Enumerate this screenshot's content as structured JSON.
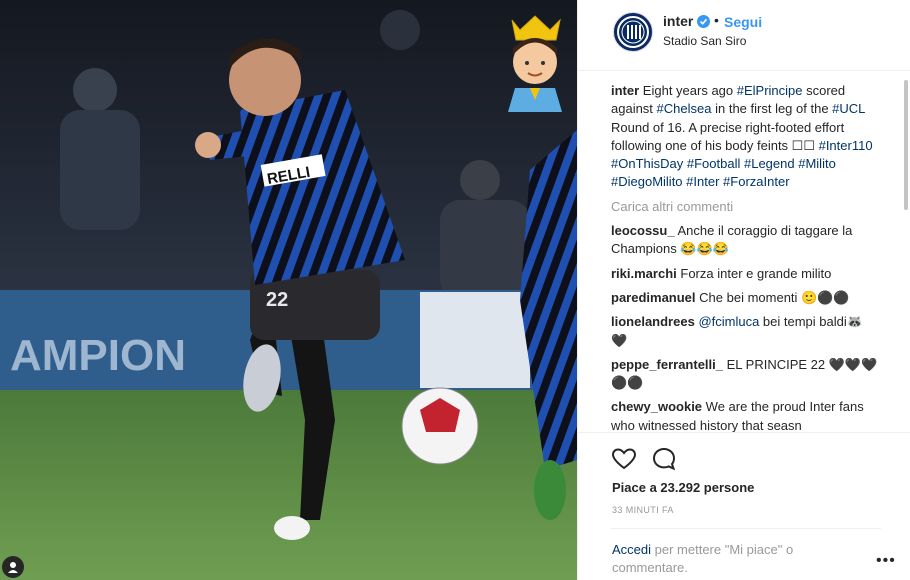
{
  "post": {
    "username": "inter",
    "follow_label": "Segui",
    "separator": "•",
    "location": "Stadio San Siro",
    "jersey_number": "22",
    "sponsor_text": "RELLI",
    "banner_text": "AMPION"
  },
  "caption": {
    "username": "inter",
    "text_parts": [
      "Eight years ago ",
      "#ElPrincipe",
      " scored against ",
      "#Chelsea",
      " in the first leg of the ",
      "#UCL",
      " Round of 16. A precise right-footed effort following one of his body feints ☐☐ ",
      "#Inter110",
      " ",
      "#OnThisDay",
      " ",
      "#Football",
      " ",
      "#Legend",
      " ",
      "#Milito",
      " ",
      "#DiegoMilito",
      " ",
      "#Inter",
      " ",
      "#ForzaInter"
    ]
  },
  "load_more_label": "Carica altri commenti",
  "comments": [
    {
      "user": "leocossu_",
      "text": "Anche il coraggio di taggare la Champions 😂😂😂"
    },
    {
      "user": "riki.marchi",
      "text": "Forza inter e grande milito"
    },
    {
      "user": "paredimanuel",
      "text": "Che bei momenti 🙂⚫⚫"
    },
    {
      "user": "lionelandrees",
      "mention": "@fcimluca",
      "text": " bei tempi baldi🦝 🖤"
    },
    {
      "user": "peppe_ferrantelli_",
      "text": "EL PRINCIPE 22 🖤🖤🖤 ⚫⚫"
    },
    {
      "user": "chewy_wookie",
      "text": "We are the proud Inter fans who witnessed history that seasn"
    }
  ],
  "likes_label": "Piace a 23.292 persone",
  "timestamp": "33 MINUTI FA",
  "login": {
    "link": "Accedi",
    "rest": " per mettere \"Mi piace\" o commentare."
  },
  "more_label": "•••",
  "icons": {
    "like": "heart-icon",
    "comment": "comment-icon",
    "verified": "verified-badge-icon",
    "user_tag": "user-tag-icon",
    "more": "more-options-icon"
  },
  "colors": {
    "accent": "#3897f0",
    "link": "#003569",
    "muted": "#999999",
    "text": "#262626",
    "inter_blue": "#0b2a63"
  }
}
